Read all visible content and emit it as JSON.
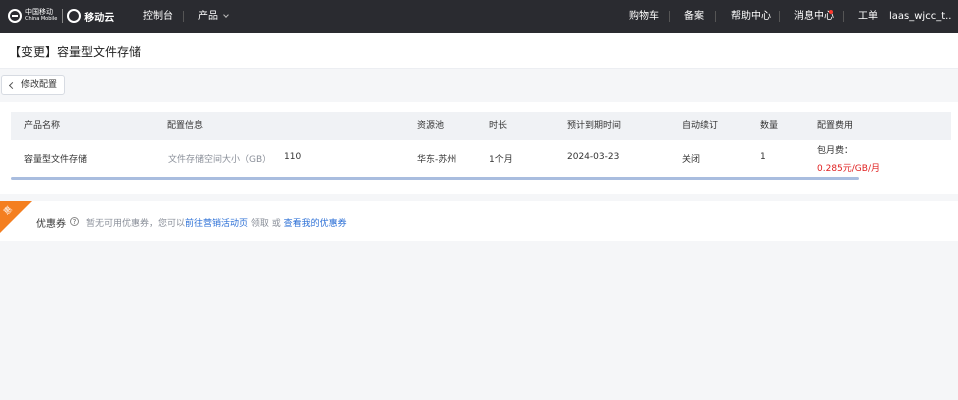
{
  "topbar": {
    "logo_cn": "中国移动",
    "logo_en": "China Mobile",
    "logo_product": "移动云",
    "console": "控制台",
    "products": "产品",
    "cart": "购物车",
    "filing": "备案",
    "help": "帮助中心",
    "messages": "消息中心",
    "ticket": "工单",
    "username": "laas_wjcc_t..."
  },
  "page": {
    "title": "【变更】容量型文件存储",
    "back_button": "修改配置"
  },
  "table": {
    "headers": {
      "product": "产品名称",
      "config": "配置信息",
      "pool": "资源池",
      "duration": "时长",
      "expiry": "预计到期时间",
      "autorenew": "自动续订",
      "quantity": "数量",
      "fee": "配置费用"
    },
    "row": {
      "product": "容量型文件存储",
      "config_label": "文件存储空间大小（GB）",
      "config_value": "110",
      "pool": "华东-苏州",
      "duration": "1个月",
      "expiry": "2024-03-23",
      "autorenew": "关闭",
      "quantity": "1",
      "fee_label": "包月费：",
      "fee_value": "0.285元/GB/月"
    }
  },
  "coupon": {
    "ribbon": "惠",
    "label": "优惠券",
    "desc_prefix": "暂无可用优惠券，您可以",
    "link_activity": "前往营销活动页",
    "desc_mid": " 领取 或 ",
    "link_mine": "查看我的优惠券"
  },
  "colors": {
    "topbar_bg": "#2a2b30",
    "accent_link": "#2b6fd6",
    "price_red": "#e02020",
    "ribbon_orange": "#f47f20"
  }
}
